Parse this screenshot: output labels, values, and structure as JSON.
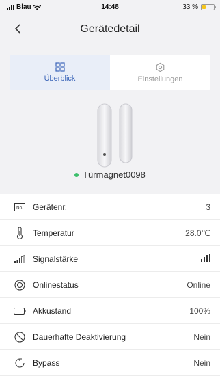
{
  "status_bar": {
    "carrier": "Blau",
    "time": "14:48",
    "battery_text": "33 %",
    "battery_level": 0.33,
    "battery_color": "#f5c518"
  },
  "nav": {
    "title": "Gerätedetail",
    "back_icon": "chevron-left-icon"
  },
  "tabs": [
    {
      "label": "Überblick",
      "icon": "grid-icon",
      "active": true
    },
    {
      "label": "Einstellungen",
      "icon": "hexagon-settings-icon",
      "active": false
    }
  ],
  "device": {
    "name": "Türmagnet0098",
    "status_color": "#3cbf6b"
  },
  "rows": [
    {
      "label": "Gerätenr.",
      "value": "3",
      "icon": "number-icon"
    },
    {
      "label": "Temperatur",
      "value": "28.0℃",
      "icon": "thermometer-icon"
    },
    {
      "label": "Signalstärke",
      "value": "",
      "icon": "signal-icon",
      "value_icon": "signal-bars-icon"
    },
    {
      "label": "Onlinestatus",
      "value": "Online",
      "icon": "online-status-icon"
    },
    {
      "label": "Akkustand",
      "value": "100%",
      "icon": "battery-icon"
    },
    {
      "label": "Dauerhafte Deaktivierung",
      "value": "Nein",
      "icon": "disable-icon"
    },
    {
      "label": "Bypass",
      "value": "Nein",
      "icon": "bypass-icon"
    }
  ],
  "colors": {
    "accent": "#3a64b8",
    "tab_active_bg": "#e9eef8",
    "background": "#f2f2f4"
  }
}
